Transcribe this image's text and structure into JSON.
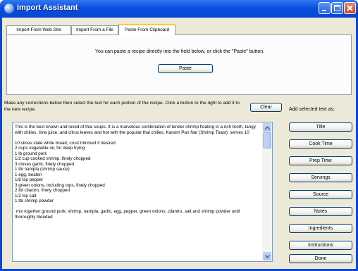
{
  "window": {
    "title": "Import Assistant",
    "controls": {
      "minimize": "minimize-icon",
      "maximize": "maximize-icon",
      "close": "close-icon"
    }
  },
  "tabs": [
    {
      "label": "Import From Web Site",
      "selected": false
    },
    {
      "label": "Import From a File",
      "selected": false
    },
    {
      "label": "Paste From Clipboard",
      "selected": true
    }
  ],
  "paste_panel": {
    "message": "You can paste a recipe directly into the field below, or click the \"Paste\" button.",
    "paste_label": "Paste"
  },
  "instructions": "Make any corrections below then select the text for each portion of the recipe. Click a button to the right to add it to the new recipe.",
  "clear_label": "Clear",
  "add_selected_label": "Add selected text as:",
  "recipe_text": "This is the best known and loved of thai soups. It is a marvelous combination of tender shrimp floating in a rich broth, tangy with chilies, lime juice, and citrus leaves and hot with the popular thai chilies. Kanom Pan Nar (Shrimp Toast)  serves 10\n\n10 slices stale white bread, crust trimmed if desired\n2 cups vegetable oil, for deep frying\n1 lb ground pork\n1/2 cup cooked shrimp, finely chopped\n3 cloves garlic, finely chopped\n1 tbl nampla (shrimp sauce)\n1 egg, beaten\n1/8 tsp pepper\n3 green onions, including tops, finely chopped\n2 tbl cilantro, finely chopped\n1/2 tsp salt\n1 tbl shrimp powder\n\n mix together ground pork, shrimp, nampla, garlic, egg, pepper, green onions, cilantro, salt and shrimp powder until thoroughly blended",
  "section_buttons": [
    "Title",
    "Cook Time",
    "Prep Time",
    "Servings",
    "Source",
    "Notes",
    "Ingredients",
    "Instructions"
  ],
  "done_label": "Done"
}
